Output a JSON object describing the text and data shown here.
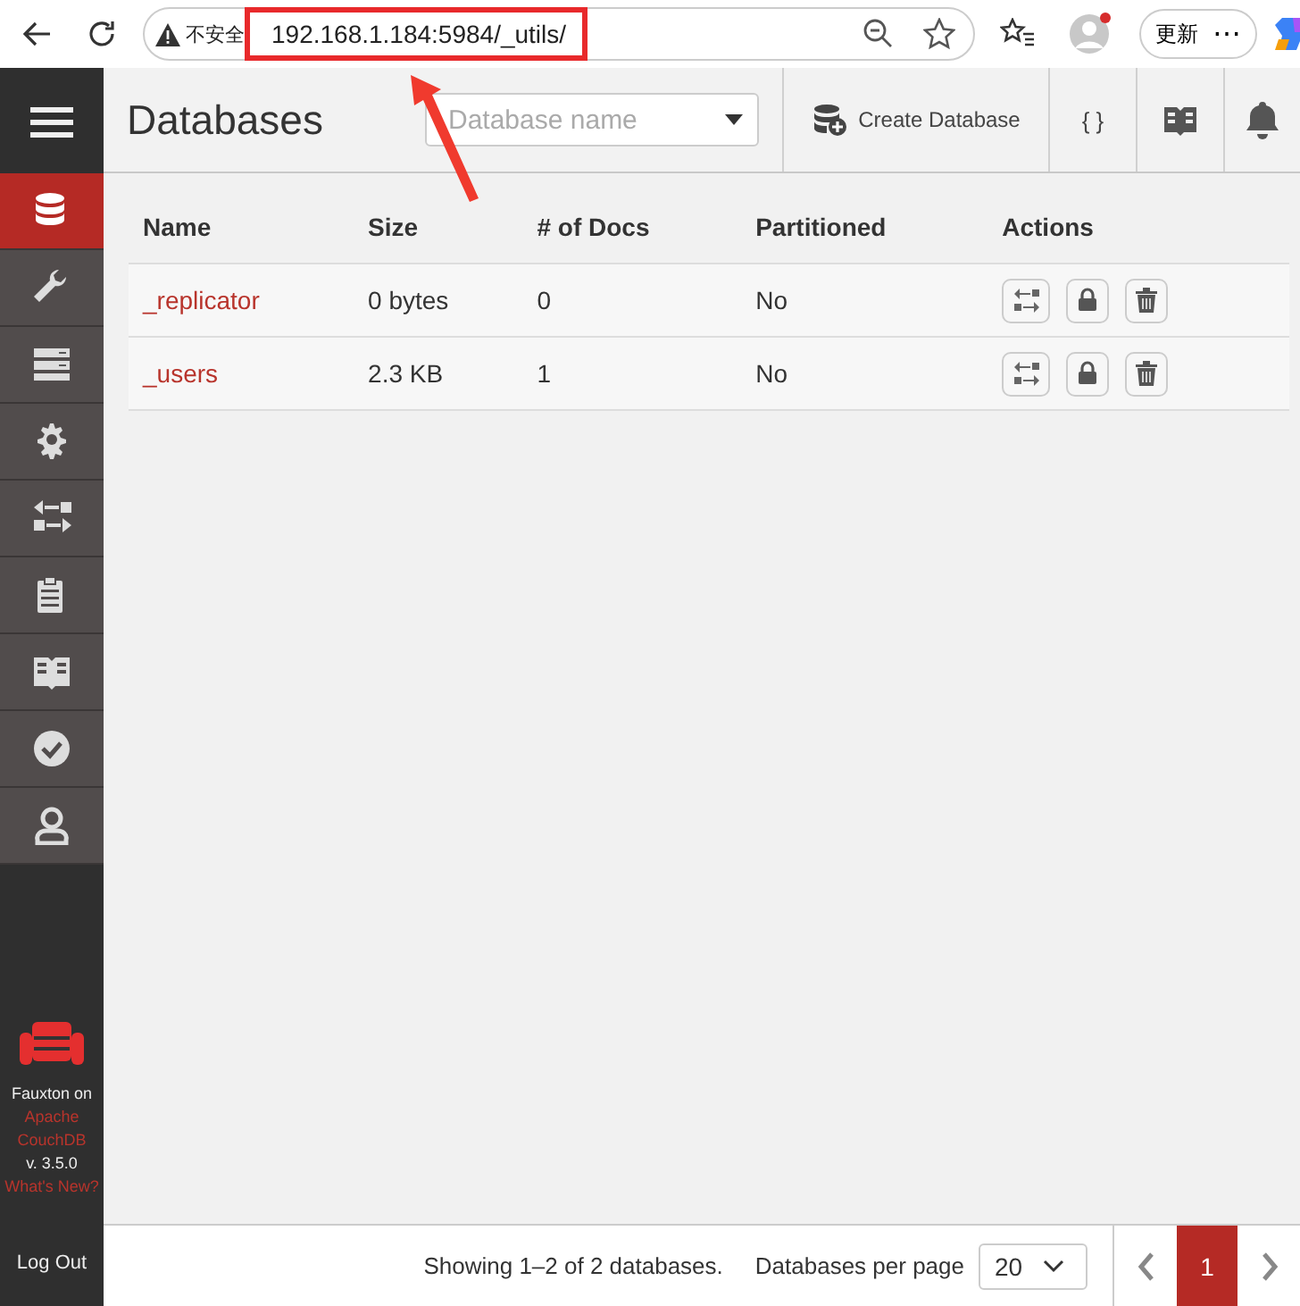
{
  "browser": {
    "security": "不安全",
    "url": "192.168.1.184:5984/_utils/",
    "update_button": "更新",
    "more_button": "⋯"
  },
  "sidebar": {
    "items": [
      {
        "kind": "database",
        "selected": true
      },
      {
        "kind": "wrench",
        "selected": false
      },
      {
        "kind": "server",
        "selected": false
      },
      {
        "kind": "gear",
        "selected": false
      },
      {
        "kind": "replicate",
        "selected": false
      },
      {
        "kind": "clipboard",
        "selected": false
      },
      {
        "kind": "book",
        "selected": false
      },
      {
        "kind": "check",
        "selected": false
      },
      {
        "kind": "user",
        "selected": false
      }
    ],
    "brand": {
      "line1": "Fauxton on",
      "link1": "Apache",
      "link2": "CouchDB",
      "version": "v. 3.5.0",
      "whats_new": "What's New?"
    },
    "logout": "Log Out"
  },
  "header": {
    "title": "Databases",
    "search": {
      "placeholder": "Database name"
    },
    "create_button": "Create Database",
    "json_button": "{ }"
  },
  "table": {
    "columns": [
      "Name",
      "Size",
      "# of Docs",
      "Partitioned",
      "Actions"
    ],
    "rows": [
      {
        "name": "_replicator",
        "size": "0 bytes",
        "docs": "0",
        "partitioned": "No"
      },
      {
        "name": "_users",
        "size": "2.3 KB",
        "docs": "1",
        "partitioned": "No"
      }
    ]
  },
  "footer": {
    "summary": "Showing 1–2 of 2 databases.",
    "per_page_label": "Databases per page",
    "per_page_value": "20",
    "pages": [
      {
        "label": "1",
        "selected": true
      }
    ]
  }
}
